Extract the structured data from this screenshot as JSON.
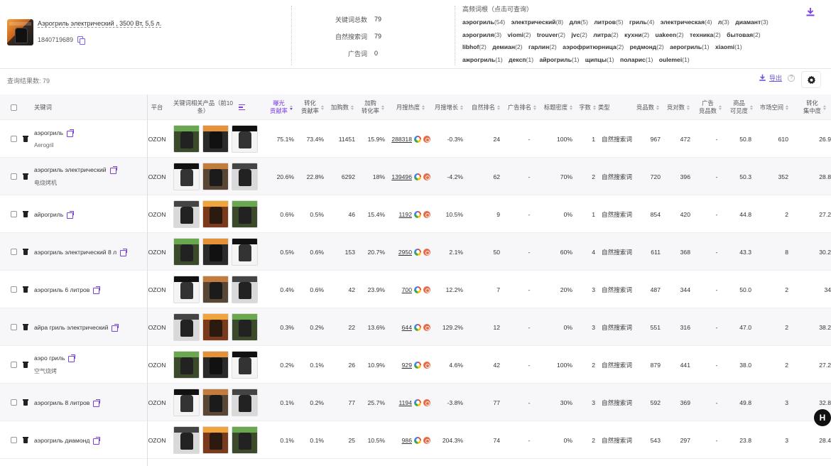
{
  "product": {
    "title": "Аэрогриль электрический , 3500 Вт, 5,5 л.",
    "id": "1840719689"
  },
  "stats": [
    {
      "label": "关键词总数",
      "value": "79"
    },
    {
      "label": "自然搜索词",
      "value": "79"
    },
    {
      "label": "广告词",
      "value": "0"
    }
  ],
  "roots": {
    "title": "高频词根（点击可查询）",
    "tags": [
      {
        "w": "аэрогриль",
        "n": "(54)"
      },
      {
        "w": "электрический",
        "n": "(8)"
      },
      {
        "w": "для",
        "n": "(5)"
      },
      {
        "w": "литров",
        "n": "(5)"
      },
      {
        "w": "гриль",
        "n": "(4)"
      },
      {
        "w": "электрическая",
        "n": "(4)"
      },
      {
        "w": "л",
        "n": "(3)"
      },
      {
        "w": "диамант",
        "n": "(3)"
      },
      {
        "w": "аэрогриля",
        "n": "(3)"
      },
      {
        "w": "viomi",
        "n": "(2)"
      },
      {
        "w": "trouver",
        "n": "(2)"
      },
      {
        "w": "jvc",
        "n": "(2)"
      },
      {
        "w": "литра",
        "n": "(2)"
      },
      {
        "w": "кухни",
        "n": "(2)"
      },
      {
        "w": "uakeen",
        "n": "(2)"
      },
      {
        "w": "техника",
        "n": "(2)"
      },
      {
        "w": "бытовая",
        "n": "(2)"
      },
      {
        "w": "libhof",
        "n": "(2)"
      },
      {
        "w": "демиан",
        "n": "(2)"
      },
      {
        "w": "гарлин",
        "n": "(2)"
      },
      {
        "w": "аэрофритюрница",
        "n": "(2)"
      },
      {
        "w": "редмонд",
        "n": "(2)"
      },
      {
        "w": "аерогриль",
        "n": "(1)"
      },
      {
        "w": "xiaomi",
        "n": "(1)"
      },
      {
        "w": "ажрогриль",
        "n": "(1)"
      },
      {
        "w": "дексп",
        "n": "(1)"
      },
      {
        "w": "айрогриль",
        "n": "(1)"
      },
      {
        "w": "щипцы",
        "n": "(1)"
      },
      {
        "w": "поларис",
        "n": "(1)"
      },
      {
        "w": "oulemei",
        "n": "(1)"
      }
    ]
  },
  "toolbar": {
    "result_label": "查询结果数:",
    "result_count": "79",
    "export_label": "导出",
    "help": "?"
  },
  "columns": {
    "keyword": "关键词",
    "platform": "平台",
    "products": "关键词相关产品（前10条）",
    "exposure": [
      "曝光",
      "贡献率"
    ],
    "conversion": [
      "转化",
      "贡献率"
    ],
    "cart": "加购数",
    "cart_rate": [
      "加购",
      "转化率"
    ],
    "heat": "月搜热度",
    "growth": "月搜增长",
    "natural_rank": "自然排名",
    "ad_rank": "广告排名",
    "title_density": "标题密度",
    "chars": "字数",
    "type": "类型",
    "competitors": "竞品数",
    "paid_competitors": "竞对数",
    "ad_competitors": [
      "广告",
      "竞品数"
    ],
    "visibility": [
      "商品",
      "可见度"
    ],
    "market_space": "市场空间",
    "concentration": [
      "转化",
      "集中度"
    ]
  },
  "rows": [
    {
      "kw": "аэрогриль",
      "sub": "Aerogril",
      "platform": "OZON",
      "exposure": "75.1%",
      "conversion": "73.4%",
      "cart": "11451",
      "cart_rate": "15.9%",
      "heat": "288318",
      "growth": "-0.3%",
      "natural_rank": "24",
      "ad_rank": "-",
      "title_density": "100%",
      "chars": "1",
      "type": "自然搜索词",
      "competitors": "967",
      "paid": "472",
      "ad_comp": "-",
      "visibility": "50.8",
      "market": "610",
      "conc": "26.9"
    },
    {
      "kw": "аэрогриль электрический",
      "sub": "电烧烤机",
      "platform": "OZON",
      "exposure": "20.6%",
      "conversion": "22.8%",
      "cart": "6292",
      "cart_rate": "18%",
      "heat": "139496",
      "growth": "-4.2%",
      "natural_rank": "62",
      "ad_rank": "-",
      "title_density": "70%",
      "chars": "2",
      "type": "自然搜索词",
      "competitors": "720",
      "paid": "396",
      "ad_comp": "-",
      "visibility": "50.3",
      "market": "352",
      "conc": "28.8"
    },
    {
      "kw": "айрогриль",
      "sub": "",
      "platform": "OZON",
      "exposure": "0.6%",
      "conversion": "0.5%",
      "cart": "46",
      "cart_rate": "15.4%",
      "heat": "1192",
      "growth": "10.5%",
      "natural_rank": "9",
      "ad_rank": "-",
      "title_density": "0%",
      "chars": "1",
      "type": "自然搜索词",
      "competitors": "854",
      "paid": "420",
      "ad_comp": "-",
      "visibility": "44.8",
      "market": "2",
      "conc": "27.2"
    },
    {
      "kw": "аэрогриль электрический 8 л",
      "sub": "",
      "platform": "OZON",
      "exposure": "0.5%",
      "conversion": "0.6%",
      "cart": "153",
      "cart_rate": "20.7%",
      "heat": "2950",
      "growth": "2.1%",
      "natural_rank": "50",
      "ad_rank": "-",
      "title_density": "60%",
      "chars": "4",
      "type": "自然搜索词",
      "competitors": "611",
      "paid": "368",
      "ad_comp": "-",
      "visibility": "43.3",
      "market": "8",
      "conc": "30.2"
    },
    {
      "kw": "аэрогриль 6 литров",
      "sub": "",
      "platform": "OZON",
      "exposure": "0.4%",
      "conversion": "0.6%",
      "cart": "42",
      "cart_rate": "23.9%",
      "heat": "700",
      "growth": "12.2%",
      "natural_rank": "7",
      "ad_rank": "-",
      "title_density": "20%",
      "chars": "3",
      "type": "自然搜索词",
      "competitors": "487",
      "paid": "344",
      "ad_comp": "-",
      "visibility": "50.0",
      "market": "2",
      "conc": "34"
    },
    {
      "kw": "айра гриль электрический",
      "sub": "",
      "platform": "OZON",
      "exposure": "0.3%",
      "conversion": "0.2%",
      "cart": "22",
      "cart_rate": "13.6%",
      "heat": "644",
      "growth": "129.2%",
      "natural_rank": "12",
      "ad_rank": "-",
      "title_density": "0%",
      "chars": "3",
      "type": "自然搜索词",
      "competitors": "551",
      "paid": "316",
      "ad_comp": "-",
      "visibility": "47.0",
      "market": "2",
      "conc": "38.2"
    },
    {
      "kw": "аэро гриль",
      "sub": "空气烧烤",
      "platform": "OZON",
      "exposure": "0.2%",
      "conversion": "0.1%",
      "cart": "26",
      "cart_rate": "10.9%",
      "heat": "929",
      "growth": "4.6%",
      "natural_rank": "42",
      "ad_rank": "-",
      "title_density": "100%",
      "chars": "2",
      "type": "自然搜索词",
      "competitors": "879",
      "paid": "441",
      "ad_comp": "-",
      "visibility": "38.0",
      "market": "2",
      "conc": "27.2"
    },
    {
      "kw": "аэрогриль 8 литров",
      "sub": "",
      "platform": "OZON",
      "exposure": "0.1%",
      "conversion": "0.2%",
      "cart": "77",
      "cart_rate": "25.7%",
      "heat": "1194",
      "growth": "-3.8%",
      "natural_rank": "77",
      "ad_rank": "-",
      "title_density": "30%",
      "chars": "3",
      "type": "自然搜索词",
      "competitors": "592",
      "paid": "369",
      "ad_comp": "-",
      "visibility": "49.8",
      "market": "3",
      "conc": "32.8"
    },
    {
      "kw": "аэрогриль диамонд",
      "sub": "",
      "platform": "OZON",
      "exposure": "0.1%",
      "conversion": "0.1%",
      "cart": "25",
      "cart_rate": "10.5%",
      "heat": "986",
      "growth": "204.3%",
      "natural_rank": "74",
      "ad_rank": "-",
      "title_density": "0%",
      "chars": "2",
      "type": "自然搜索词",
      "competitors": "543",
      "paid": "297",
      "ad_comp": "-",
      "visibility": "23.8",
      "market": "3",
      "conc": "28.4"
    }
  ],
  "fab_label": "H",
  "colors": {
    "accent": "#7b3fe4",
    "export": "#6b4fd8",
    "alt_row": "#f7f7f9"
  }
}
